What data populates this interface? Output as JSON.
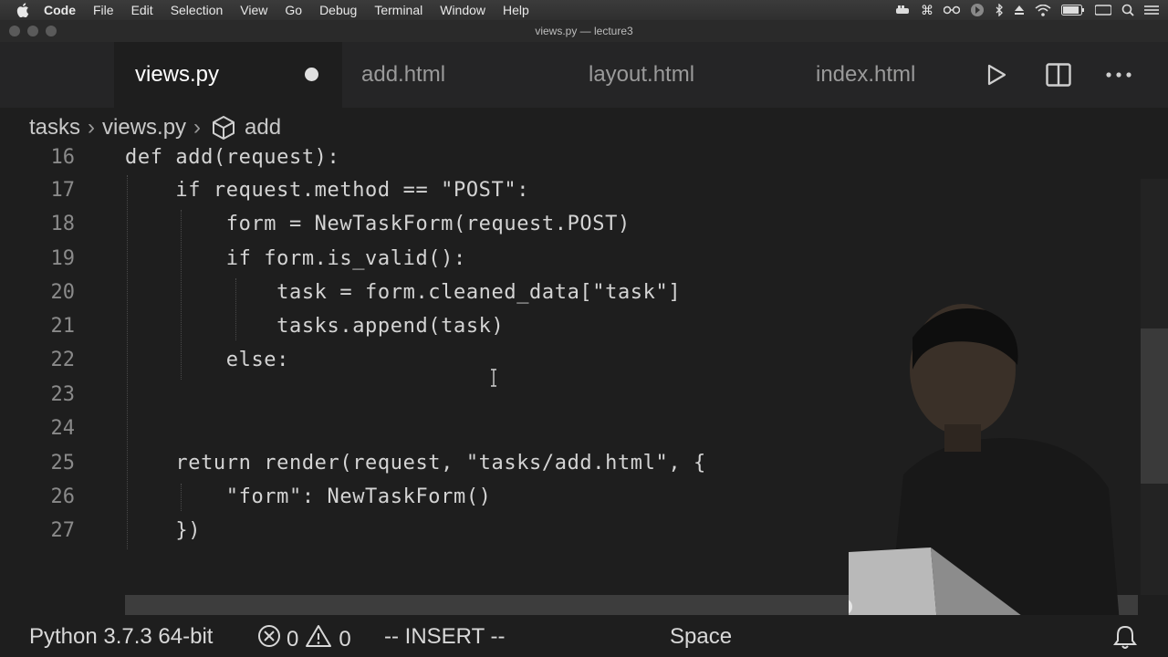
{
  "menubar": {
    "items": [
      "Code",
      "File",
      "Edit",
      "Selection",
      "View",
      "Go",
      "Debug",
      "Terminal",
      "Window",
      "Help"
    ]
  },
  "window": {
    "title": "views.py — lecture3"
  },
  "tabs": [
    {
      "label": "views.py",
      "active": true,
      "modified": true
    },
    {
      "label": "add.html",
      "active": false
    },
    {
      "label": "layout.html",
      "active": false
    },
    {
      "label": "index.html",
      "active": false
    }
  ],
  "tab_actions": [
    "run-icon",
    "split-editor-icon",
    "more-icon"
  ],
  "breadcrumb": {
    "folder": "tasks",
    "file": "views.py",
    "symbol": "add"
  },
  "code_lines": [
    {
      "n": "16",
      "text": "def add(request):"
    },
    {
      "n": "17",
      "text": "    if request.method == \"POST\":"
    },
    {
      "n": "18",
      "text": "        form = NewTaskForm(request.POST)"
    },
    {
      "n": "19",
      "text": "        if form.is_valid():"
    },
    {
      "n": "20",
      "text": "            task = form.cleaned_data[\"task\"]"
    },
    {
      "n": "21",
      "text": "            tasks.append(task)"
    },
    {
      "n": "22",
      "text": "        else:"
    },
    {
      "n": "23",
      "text": ""
    },
    {
      "n": "24",
      "text": ""
    },
    {
      "n": "25",
      "text": "    return render(request, \"tasks/add.html\", {"
    },
    {
      "n": "26",
      "text": "        \"form\": NewTaskForm()"
    },
    {
      "n": "27",
      "text": "    })"
    }
  ],
  "statusbar": {
    "python": "Python 3.7.3 64-bit",
    "errors": "0",
    "warnings": "0",
    "mode": "-- INSERT --",
    "spaces": "Space"
  },
  "colors": {
    "editor_bg": "#1e1e1e",
    "tabbar_bg": "#252526"
  }
}
